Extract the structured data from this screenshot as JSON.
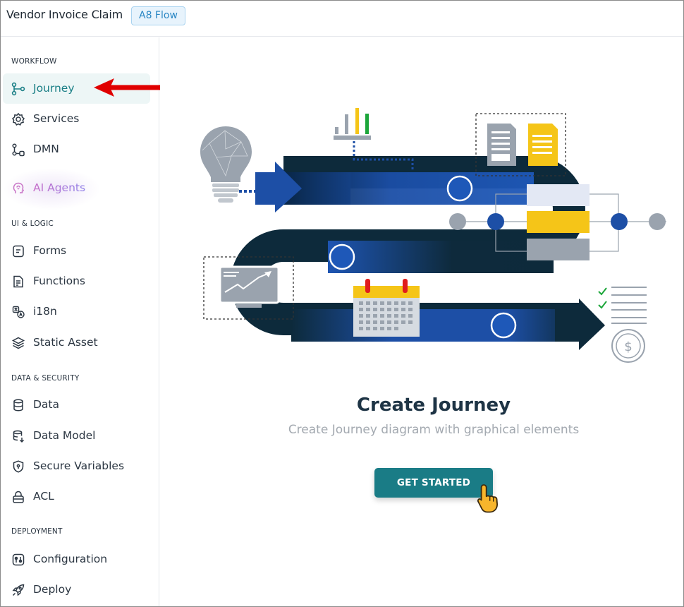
{
  "header": {
    "title": "Vendor Invoice Claim",
    "badge": "A8 Flow"
  },
  "sidebar": {
    "sections": [
      {
        "title": "WORKFLOW"
      },
      {
        "title": "UI & LOGIC"
      },
      {
        "title": "DATA & SECURITY"
      },
      {
        "title": "DEPLOYMENT"
      }
    ],
    "items": [
      {
        "label": "Journey",
        "icon": "journey-icon",
        "active": true
      },
      {
        "label": "Services",
        "icon": "gear-icon"
      },
      {
        "label": "DMN",
        "icon": "dmn-icon"
      },
      {
        "label": "AI Agents",
        "icon": "ai-head-icon"
      },
      {
        "label": "Forms",
        "icon": "form-icon"
      },
      {
        "label": "Functions",
        "icon": "function-icon"
      },
      {
        "label": "i18n",
        "icon": "translate-icon"
      },
      {
        "label": "Static Asset",
        "icon": "layers-icon"
      },
      {
        "label": "Data",
        "icon": "database-icon"
      },
      {
        "label": "Data Model",
        "icon": "data-model-icon"
      },
      {
        "label": "Secure Variables",
        "icon": "shield-icon"
      },
      {
        "label": "ACL",
        "icon": "lock-icon"
      },
      {
        "label": "Configuration",
        "icon": "sliders-icon"
      },
      {
        "label": "Deploy",
        "icon": "rocket-icon"
      }
    ]
  },
  "main": {
    "title": "Create Journey",
    "subtitle": "Create Journey diagram with graphical elements",
    "cta_label": "GET STARTED"
  },
  "colors": {
    "accent": "#1a7c86",
    "active_bg": "#edf6f6",
    "road_dark": "#0e2a3c",
    "road_blue": "#1d4fa6",
    "annotation_red": "#e00000",
    "badge_blue": "#2a87c4"
  }
}
